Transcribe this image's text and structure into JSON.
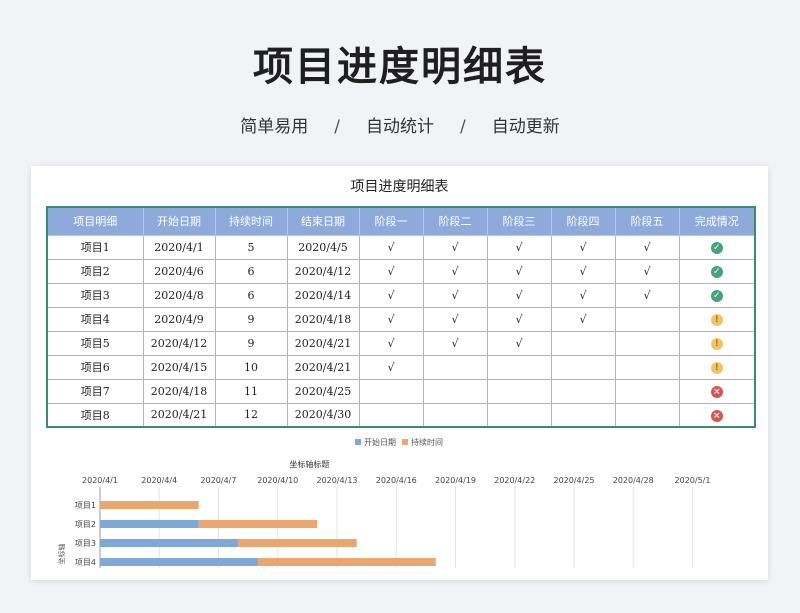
{
  "hero": {
    "title": "项目进度明细表",
    "subtitle_items": [
      "简单易用",
      "自动统计",
      "自动更新"
    ],
    "separator": "/"
  },
  "sheet": {
    "title": "项目进度明细表",
    "headers": [
      "项目明细",
      "开始日期",
      "持续时间",
      "结束日期",
      "阶段一",
      "阶段二",
      "阶段三",
      "阶段四",
      "阶段五",
      "完成情况"
    ],
    "rows": [
      {
        "name": "项目1",
        "start": "2020/4/1",
        "duration": "5",
        "end": "2020/4/5",
        "stages": [
          "√",
          "√",
          "√",
          "√",
          "√"
        ],
        "status": "done"
      },
      {
        "name": "项目2",
        "start": "2020/4/6",
        "duration": "6",
        "end": "2020/4/12",
        "stages": [
          "√",
          "√",
          "√",
          "√",
          "√"
        ],
        "status": "done"
      },
      {
        "name": "项目3",
        "start": "2020/4/8",
        "duration": "6",
        "end": "2020/4/14",
        "stages": [
          "√",
          "√",
          "√",
          "√",
          "√"
        ],
        "status": "done"
      },
      {
        "name": "项目4",
        "start": "2020/4/9",
        "duration": "9",
        "end": "2020/4/18",
        "stages": [
          "√",
          "√",
          "√",
          "√",
          ""
        ],
        "status": "progress"
      },
      {
        "name": "项目5",
        "start": "2020/4/12",
        "duration": "9",
        "end": "2020/4/21",
        "stages": [
          "√",
          "√",
          "√",
          "",
          ""
        ],
        "status": "progress"
      },
      {
        "name": "项目6",
        "start": "2020/4/15",
        "duration": "10",
        "end": "2020/4/21",
        "stages": [
          "√",
          "",
          "",
          "",
          ""
        ],
        "status": "progress"
      },
      {
        "name": "项目7",
        "start": "2020/4/18",
        "duration": "11",
        "end": "2020/4/25",
        "stages": [
          "",
          "",
          "",
          "",
          ""
        ],
        "status": "notstart"
      },
      {
        "name": "项目8",
        "start": "2020/4/21",
        "duration": "12",
        "end": "2020/4/30",
        "stages": [
          "",
          "",
          "",
          "",
          ""
        ],
        "status": "notstart"
      }
    ],
    "status_icons": {
      "done": "check-circle-icon",
      "progress": "exclamation-circle-icon",
      "notstart": "x-circle-icon"
    },
    "status_glyphs": {
      "done": "✓",
      "progress": "!",
      "notstart": "×"
    }
  },
  "chart_data": {
    "type": "bar",
    "orientation": "horizontal-stacked",
    "title": "坐标轴标题",
    "ylabel": "坐标轴",
    "categories": [
      "项目1",
      "项目2",
      "项目3",
      "项目4"
    ],
    "x_ticks": [
      "2020/4/1",
      "2020/4/4",
      "2020/4/7",
      "2020/4/10",
      "2020/4/13",
      "2020/4/16",
      "2020/4/19",
      "2020/4/22",
      "2020/4/25",
      "2020/4/28",
      "2020/5/1"
    ],
    "series": [
      {
        "name": "开始日期",
        "color": "#7fa8d6",
        "start_values": [
          "2020/4/1",
          "2020/4/6",
          "2020/4/8",
          "2020/4/9"
        ]
      },
      {
        "name": "持续时间",
        "color": "#e9a76f",
        "values": [
          5,
          6,
          6,
          9
        ]
      }
    ],
    "legend_position": "top-center",
    "grid": true
  }
}
